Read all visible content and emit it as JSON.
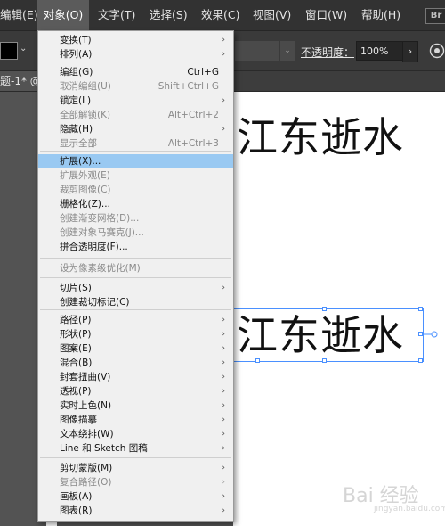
{
  "menubar": {
    "items": [
      {
        "label": "编辑(E)",
        "active": false
      },
      {
        "label": "对象(O)",
        "active": true
      },
      {
        "label": "文字(T)",
        "active": false
      },
      {
        "label": "选择(S)",
        "active": false
      },
      {
        "label": "效果(C)",
        "active": false
      },
      {
        "label": "视图(V)",
        "active": false
      },
      {
        "label": "窗口(W)",
        "active": false
      },
      {
        "label": "帮助(H)",
        "active": false
      }
    ],
    "bridge_icon_label": "Br"
  },
  "controlbar": {
    "fill_color": "#000000",
    "opacity_label": "不透明度：",
    "opacity_value": "100%"
  },
  "tab": {
    "label": "题-1* @"
  },
  "canvas": {
    "text_1": "江东逝水",
    "text_2": "江东逝水",
    "watermark": "Bai 经验",
    "watermark_sub": "jingyan.baidu.com"
  },
  "object_menu": {
    "items": [
      {
        "label": "变换(T)",
        "shortcut": "",
        "submenu": true,
        "disabled": false,
        "highlight": false
      },
      {
        "label": "排列(A)",
        "shortcut": "",
        "submenu": true,
        "disabled": false,
        "highlight": false
      },
      {
        "label": "编组(G)",
        "shortcut": "Ctrl+G",
        "submenu": false,
        "disabled": false,
        "highlight": false
      },
      {
        "label": "取消编组(U)",
        "shortcut": "Shift+Ctrl+G",
        "submenu": false,
        "disabled": true,
        "highlight": false
      },
      {
        "label": "锁定(L)",
        "shortcut": "",
        "submenu": true,
        "disabled": false,
        "highlight": false
      },
      {
        "label": "全部解锁(K)",
        "shortcut": "Alt+Ctrl+2",
        "submenu": false,
        "disabled": true,
        "highlight": false
      },
      {
        "label": "隐藏(H)",
        "shortcut": "",
        "submenu": true,
        "disabled": false,
        "highlight": false
      },
      {
        "label": "显示全部",
        "shortcut": "Alt+Ctrl+3",
        "submenu": false,
        "disabled": true,
        "highlight": false
      },
      {
        "label": "扩展(X)...",
        "shortcut": "",
        "submenu": false,
        "disabled": false,
        "highlight": true
      },
      {
        "label": "扩展外观(E)",
        "shortcut": "",
        "submenu": false,
        "disabled": true,
        "highlight": false
      },
      {
        "label": "裁剪图像(C)",
        "shortcut": "",
        "submenu": false,
        "disabled": true,
        "highlight": false
      },
      {
        "label": "栅格化(Z)...",
        "shortcut": "",
        "submenu": false,
        "disabled": false,
        "highlight": false
      },
      {
        "label": "创建渐变网格(D)...",
        "shortcut": "",
        "submenu": false,
        "disabled": true,
        "highlight": false
      },
      {
        "label": "创建对象马赛克(J)...",
        "shortcut": "",
        "submenu": false,
        "disabled": true,
        "highlight": false
      },
      {
        "label": "拼合透明度(F)...",
        "shortcut": "",
        "submenu": false,
        "disabled": false,
        "highlight": false
      },
      {
        "label": "设为像素级优化(M)",
        "shortcut": "",
        "submenu": false,
        "disabled": true,
        "highlight": false
      },
      {
        "label": "切片(S)",
        "shortcut": "",
        "submenu": true,
        "disabled": false,
        "highlight": false
      },
      {
        "label": "创建裁切标记(C)",
        "shortcut": "",
        "submenu": false,
        "disabled": false,
        "highlight": false
      },
      {
        "label": "路径(P)",
        "shortcut": "",
        "submenu": true,
        "disabled": false,
        "highlight": false
      },
      {
        "label": "形状(P)",
        "shortcut": "",
        "submenu": true,
        "disabled": false,
        "highlight": false
      },
      {
        "label": "图案(E)",
        "shortcut": "",
        "submenu": true,
        "disabled": false,
        "highlight": false
      },
      {
        "label": "混合(B)",
        "shortcut": "",
        "submenu": true,
        "disabled": false,
        "highlight": false
      },
      {
        "label": "封套扭曲(V)",
        "shortcut": "",
        "submenu": true,
        "disabled": false,
        "highlight": false
      },
      {
        "label": "透视(P)",
        "shortcut": "",
        "submenu": true,
        "disabled": false,
        "highlight": false
      },
      {
        "label": "实时上色(N)",
        "shortcut": "",
        "submenu": true,
        "disabled": false,
        "highlight": false
      },
      {
        "label": "图像描摹",
        "shortcut": "",
        "submenu": true,
        "disabled": false,
        "highlight": false
      },
      {
        "label": "文本绕排(W)",
        "shortcut": "",
        "submenu": true,
        "disabled": false,
        "highlight": false
      },
      {
        "label": "Line 和 Sketch 图稿",
        "shortcut": "",
        "submenu": true,
        "disabled": false,
        "highlight": false
      },
      {
        "label": "剪切蒙版(M)",
        "shortcut": "",
        "submenu": true,
        "disabled": false,
        "highlight": false
      },
      {
        "label": "复合路径(O)",
        "shortcut": "",
        "submenu": true,
        "disabled": true,
        "highlight": false
      },
      {
        "label": "画板(A)",
        "shortcut": "",
        "submenu": true,
        "disabled": false,
        "highlight": false
      },
      {
        "label": "图表(R)",
        "shortcut": "",
        "submenu": true,
        "disabled": false,
        "highlight": false
      }
    ]
  }
}
